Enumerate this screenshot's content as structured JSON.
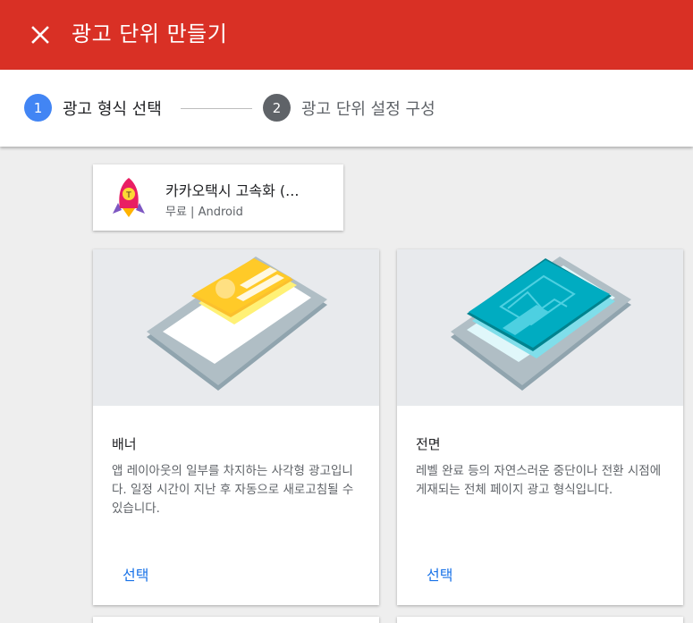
{
  "header": {
    "title": "광고 단위 만들기",
    "close_icon": "close-icon",
    "color": "#d93025"
  },
  "stepper": {
    "steps": [
      {
        "number": "1",
        "label": "광고 형식 선택",
        "state": "active"
      },
      {
        "number": "2",
        "label": "광고 단위 설정 구성",
        "state": "inactive"
      }
    ]
  },
  "app": {
    "name": "카카오택시 고속화 (...",
    "subtitle": "무료 | Android",
    "icon": "rocket-icon"
  },
  "formats": [
    {
      "title": "배너",
      "description": "앱 레이아웃의 일부를 차지하는 사각형 광고입니다. 일정 시간이 지난 후 자동으로 새로고침될 수 있습니다.",
      "select_label": "선택",
      "illustration": "banner-illustration"
    },
    {
      "title": "전면",
      "description": "레벨 완료 등의 자연스러운 중단이나 전환 시점에 게재되는 전체 페이지 광고 형식입니다.",
      "select_label": "선택",
      "illustration": "interstitial-illustration"
    }
  ],
  "colors": {
    "accent": "#1a73e8",
    "step_active": "#4285f4",
    "step_inactive": "#5f6368"
  }
}
